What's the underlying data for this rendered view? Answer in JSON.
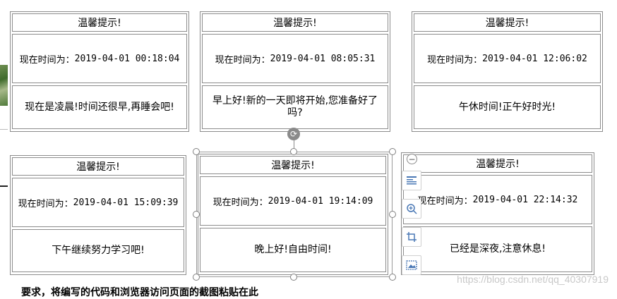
{
  "cards": [
    {
      "title": "温馨提示!",
      "time_label": "现在时间为：",
      "time_value": "2019-04-01 00:18:04",
      "message": "现在是凌晨!时间还很早,再睡会吧!"
    },
    {
      "title": "温馨提示!",
      "time_label": "现在时间为：",
      "time_value": "2019-04-01 08:05:31",
      "message": "早上好!新的一天即将开始,您准备好了吗?"
    },
    {
      "title": "温馨提示!",
      "time_label": "现在时间为：",
      "time_value": "2019-04-01 12:06:02",
      "message": "午休时间!正午好时光!"
    },
    {
      "title": "温馨提示!",
      "time_label": "现在时间为：",
      "time_value": "2019-04-01 15:09:39",
      "message": "下午继续努力学习吧!"
    },
    {
      "title": "温馨提示!",
      "time_label": "现在时间为：",
      "time_value": "2019-04-01 19:14:09",
      "message": "晚上好!自由时间!"
    },
    {
      "title": "温馨提示!",
      "time_label": "现在时间为：",
      "time_value": "2019-04-01 22:14:32",
      "message": "已经是深夜,注意休息!"
    }
  ],
  "toolbar": {
    "icons": [
      "collapse-icon",
      "layout-icon",
      "zoom-in-icon",
      "crop-icon",
      "image-icon"
    ]
  },
  "footer": {
    "instruction": "要求，将编写的代码和浏览器访问页面的截图粘贴在此",
    "watermark": "https://blog.csdn.net/qq_40307919"
  }
}
